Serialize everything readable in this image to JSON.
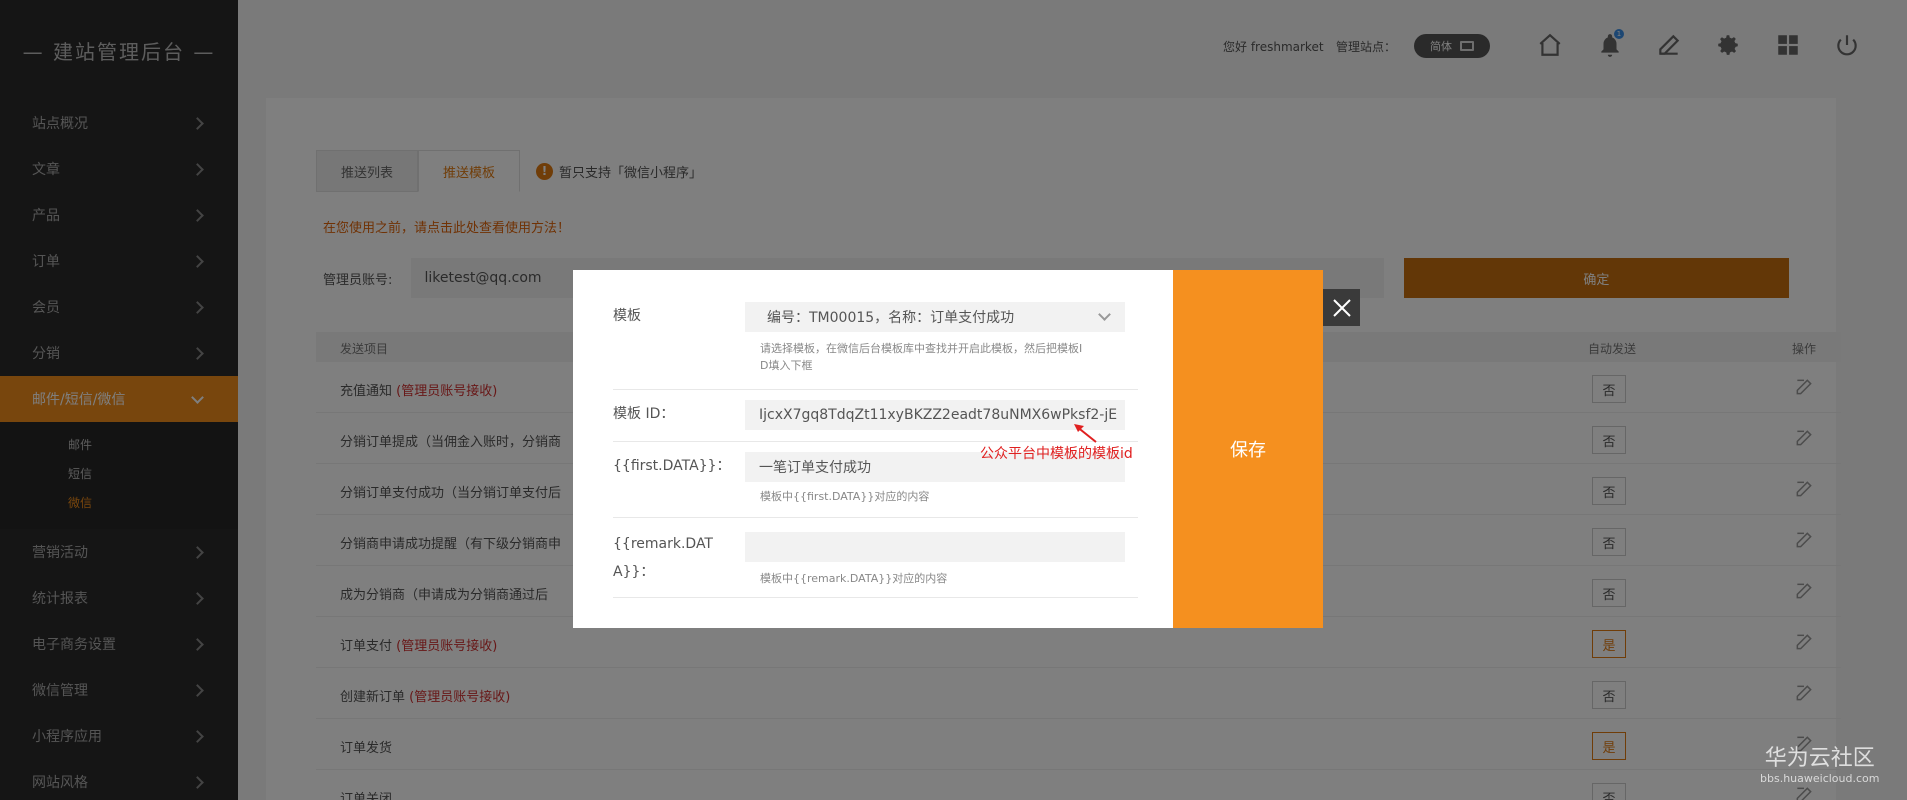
{
  "sidebar": {
    "brand": "— 建站管理后台 —",
    "items_before": [
      {
        "label": "站点概况"
      },
      {
        "label": "文章"
      },
      {
        "label": "产品"
      },
      {
        "label": "订单"
      },
      {
        "label": "会员"
      },
      {
        "label": "分销"
      }
    ],
    "active_item": "邮件/短信/微信",
    "subitems": [
      "邮件",
      "短信",
      "微信"
    ],
    "active_subitem": "微信",
    "items_after": [
      {
        "label": "营销活动"
      },
      {
        "label": "统计报表"
      },
      {
        "label": "电子商务设置"
      },
      {
        "label": "微信管理"
      },
      {
        "label": "小程序应用"
      },
      {
        "label": "网站风格"
      }
    ]
  },
  "header": {
    "greeting": "您好 freshmarket",
    "site_label": "管理站点：",
    "site_value": "简体",
    "notification_count": "1",
    "icons": [
      "home-icon",
      "bell-icon",
      "edit-icon",
      "gear-icon",
      "apps-icon",
      "power-icon"
    ]
  },
  "main": {
    "tabs": [
      "推送列表",
      "推送模板"
    ],
    "active_tab": "推送模板",
    "tab_note": "暂只支持「微信小程序」",
    "usage_link": "在您使用之前，请点击此处查看使用方法！",
    "admin_label": "管理员账号:",
    "admin_value": "liketest@qq.com",
    "confirm_label": "确定",
    "table": {
      "headers": [
        "发送项目",
        "自动发送",
        "操作"
      ],
      "rows": [
        {
          "name": "充值通知",
          "note": "(管理员账号接收)",
          "auto": "否"
        },
        {
          "name": "分销订单提成（当佣金入账时，分销商",
          "note": "",
          "auto": "否"
        },
        {
          "name": "分销订单支付成功（当分销订单支付后",
          "note": "",
          "auto": "否"
        },
        {
          "name": "分销商申请成功提醒（有下级分销商申",
          "note": "",
          "auto": "否"
        },
        {
          "name": "成为分销商（申请成为分销商通过后",
          "note": "",
          "auto": "否"
        },
        {
          "name": "订单支付",
          "note": "(管理员账号接收)",
          "auto": "是"
        },
        {
          "name": "创建新订单",
          "note": "(管理员账号接收)",
          "auto": "否"
        },
        {
          "name": "订单发货",
          "note": "",
          "auto": "是"
        },
        {
          "name": "订单关闭",
          "note": "",
          "auto": "否"
        }
      ]
    }
  },
  "modal": {
    "template_label": "模板",
    "template_value": "编号：TM00015，名称：订单支付成功",
    "template_hint_1": "请选择模板，在微信后台模板库中查找并开启此模板，然后把模板I",
    "template_hint_2": "D填入下框",
    "id_label": "模板 ID：",
    "id_value": "IjcxX7gq8TdqZt11xyBKZZ2eadt78uNMX6wPksf2-jE",
    "first_label": "{{first.DATA}}：",
    "first_value": "一笔订单支付成功",
    "first_hint": "模板中{{first.DATA}}对应的内容",
    "remark_label_1": "{{remark.DAT",
    "remark_label_2": "A}}：",
    "remark_value": "",
    "remark_hint": "模板中{{remark.DATA}}对应的内容",
    "save_label": "保存",
    "annotation": "公众平台中模板的模板id"
  },
  "watermark": {
    "title": "华为云社区",
    "url": "bbs.huaweicloud.com"
  },
  "colors": {
    "accent": "#f5901f",
    "sidebar_bg": "#2b2b2b",
    "annotation": "#e02020"
  }
}
